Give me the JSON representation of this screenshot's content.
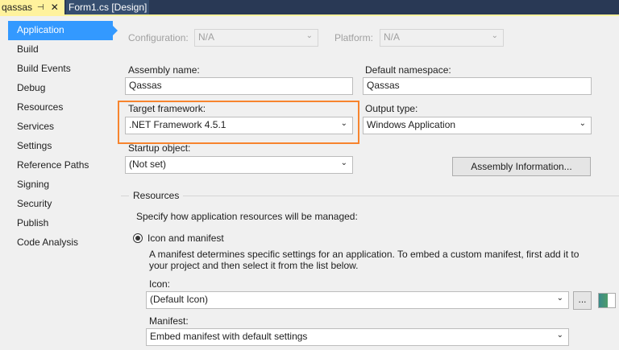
{
  "tabs": [
    {
      "label": "qassas",
      "active": true
    },
    {
      "label": "Form1.cs [Design]"
    }
  ],
  "nav": [
    "Application",
    "Build",
    "Build Events",
    "Debug",
    "Resources",
    "Services",
    "Settings",
    "Reference Paths",
    "Signing",
    "Security",
    "Publish",
    "Code Analysis"
  ],
  "config": {
    "configuration_label": "Configuration:",
    "configuration_value": "N/A",
    "platform_label": "Platform:",
    "platform_value": "N/A"
  },
  "assembly_name": {
    "label": "Assembly name:",
    "value": "Qassas"
  },
  "default_namespace": {
    "label": "Default namespace:",
    "value": "Qassas"
  },
  "target_framework": {
    "label": "Target framework:",
    "value": ".NET Framework 4.5.1"
  },
  "output_type": {
    "label": "Output type:",
    "value": "Windows Application"
  },
  "startup_object": {
    "label": "Startup object:",
    "value": "(Not set)"
  },
  "assembly_info_button": "Assembly Information...",
  "resources": {
    "title": "Resources",
    "description": "Specify how application resources will be managed:",
    "radio_label": "Icon and manifest",
    "manifest_text_1": "A manifest determines specific settings for an application. To embed a custom manifest, first add it to",
    "manifest_text_2": "your project and then select it from the list below.",
    "icon_label": "Icon:",
    "icon_value": "(Default Icon)",
    "browse_button": "...",
    "manifest_label": "Manifest:",
    "manifest_value": "Embed manifest with default settings"
  },
  "highlight_color": "#f7842e"
}
